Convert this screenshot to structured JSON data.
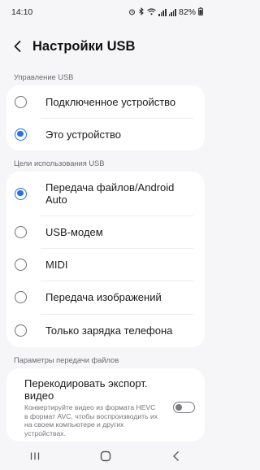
{
  "status_bar": {
    "time": "14:10",
    "battery": "82%",
    "icons": [
      "alarm-icon",
      "bluetooth-icon",
      "wifi-icon",
      "signal-icon",
      "signal-icon",
      "battery-icon"
    ]
  },
  "header": {
    "title": "Настройки USB",
    "back_icon": "back-arrow-icon"
  },
  "usb_control": {
    "section_label": "Управление USB",
    "options": [
      {
        "label": "Подключенное устройство",
        "selected": false
      },
      {
        "label": "Это устройство",
        "selected": true
      }
    ]
  },
  "usb_purpose": {
    "section_label": "Цели использования USB",
    "options": [
      {
        "label": "Передача файлов/Android Auto",
        "selected": true
      },
      {
        "label": "USB-модем",
        "selected": false
      },
      {
        "label": "MIDI",
        "selected": false
      },
      {
        "label": "Передача изображений",
        "selected": false
      },
      {
        "label": "Только зарядка телефона",
        "selected": false
      }
    ]
  },
  "file_transfer": {
    "section_label": "Параметры передачи файлов",
    "transcode_title": "Перекодировать экспорт. видео",
    "transcode_description": "Конвертируйте видео из формата HEVC в формат AVC, чтобы воспроизводить их на своем компьютере и других устройствах.",
    "transcode_enabled": false
  },
  "navbar": {
    "icons": [
      "recent-apps-icon",
      "home-icon",
      "back-icon"
    ]
  }
}
